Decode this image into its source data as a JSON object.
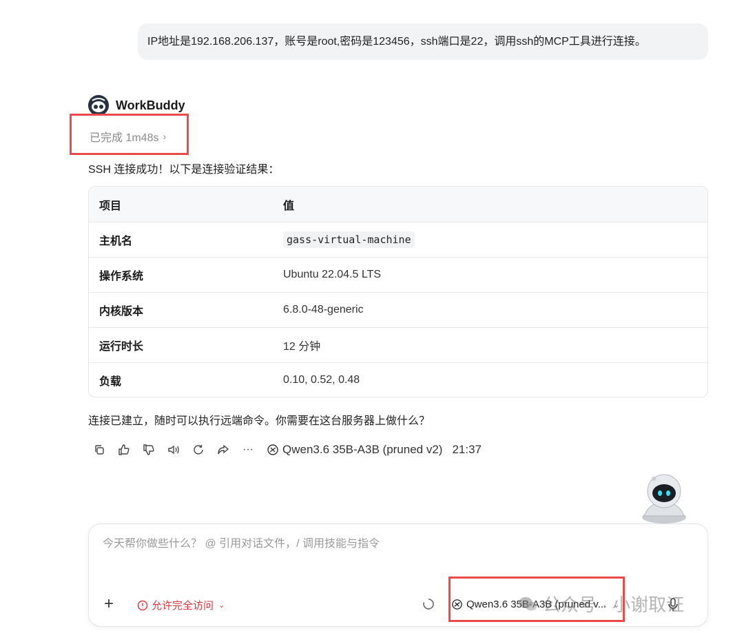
{
  "user_message": "IP地址是192.168.206.137，账号是root,密码是123456，ssh端口是22，调用ssh的MCP工具进行连接。",
  "assistant": {
    "name": "WorkBuddy",
    "status": "已完成 1m48s",
    "intro": "SSH 连接成功！以下是连接验证结果：",
    "table": {
      "headers": [
        "项目",
        "值"
      ],
      "rows": [
        {
          "key": "主机名",
          "value": "gass-virtual-machine",
          "code": true
        },
        {
          "key": "操作系统",
          "value": "Ubuntu 22.04.5 LTS",
          "code": false
        },
        {
          "key": "内核版本",
          "value": "6.8.0-48-generic",
          "code": false
        },
        {
          "key": "运行时长",
          "value": "12 分钟",
          "code": false
        },
        {
          "key": "负载",
          "value": "0.10, 0.52, 0.48",
          "code": false
        }
      ]
    },
    "outro": "连接已建立，随时可以执行远端命令。你需要在这台服务器上做什么？",
    "actions": [
      "copy-icon",
      "thumbs-up-icon",
      "thumbs-down-icon",
      "speaker-icon",
      "regenerate-icon",
      "share-icon",
      "more-icon"
    ],
    "more_label": "···",
    "model": "Qwen3.6 35B-A3B (pruned v2)",
    "time": "21:37"
  },
  "composer": {
    "placeholder": "今天帮你做些什么？ @ 引用对话文件，/ 调用技能与指令",
    "plus_label": "+",
    "permission_label": "允许完全访问",
    "model_select": "Qwen3.6 35B-A3B (pruned v...",
    "chevron": "⌄"
  },
  "watermark": "公众号 · 小谢取证",
  "colors": {
    "highlight_border": "#ea4a4a",
    "permission_red": "#d9363e",
    "bubble_bg": "#f2f3f5"
  }
}
